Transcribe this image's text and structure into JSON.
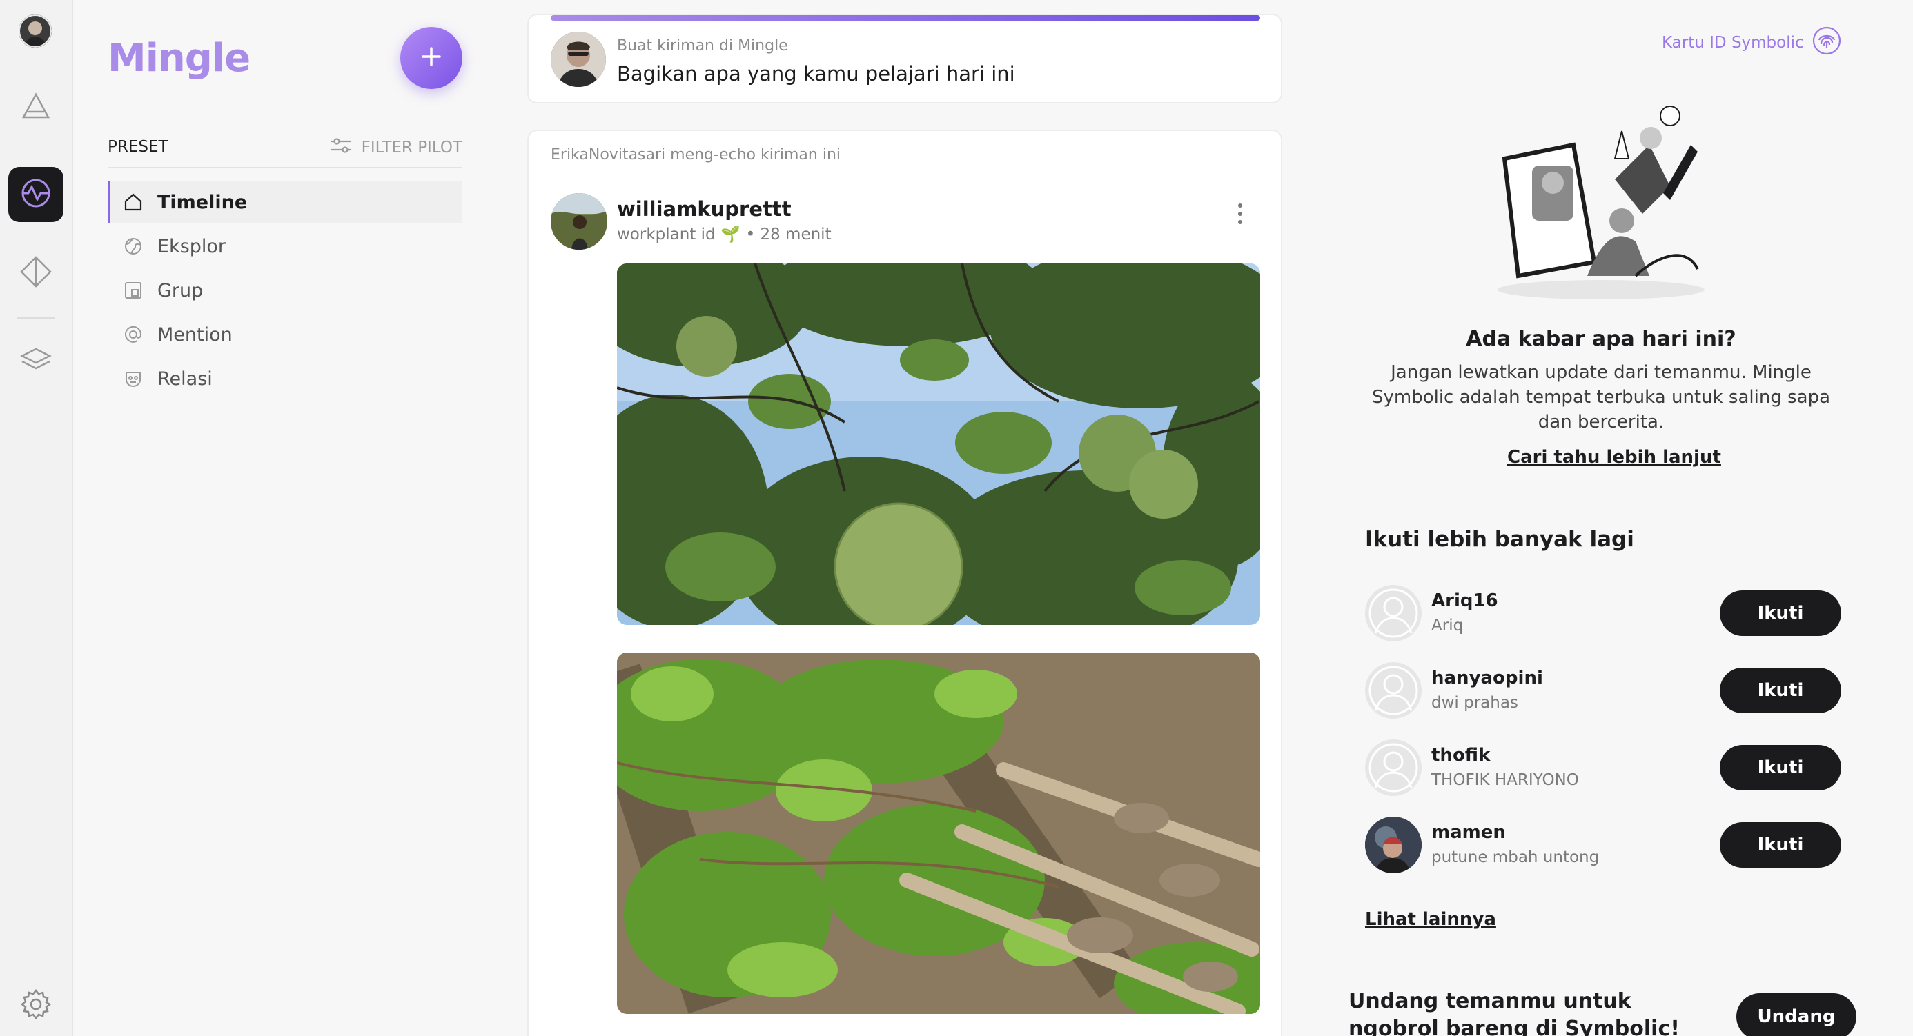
{
  "rail": {
    "items": [
      "profile-avatar",
      "triangle-icon",
      "activity-icon",
      "diamond-icon",
      "layers-icon",
      "gear-icon"
    ]
  },
  "nav": {
    "brand": "Mingle",
    "preset_label": "PRESET",
    "filter_label": "FILTER PILOT",
    "items": [
      {
        "label": "Timeline",
        "icon": "home-icon",
        "active": true
      },
      {
        "label": "Eksplor",
        "icon": "globe-icon",
        "active": false
      },
      {
        "label": "Grup",
        "icon": "group-icon",
        "active": false
      },
      {
        "label": "Mention",
        "icon": "at-icon",
        "active": false
      },
      {
        "label": "Relasi",
        "icon": "relations-icon",
        "active": false
      }
    ]
  },
  "composer": {
    "hint": "Buat kiriman di Mingle",
    "prompt": "Bagikan apa yang kamu pelajari hari ini"
  },
  "post": {
    "echo_note": "ErikaNovitasari meng-echo kiriman ini",
    "username": "williamkuprettt",
    "group": "workplant id 🌱",
    "time": "• 28 menit"
  },
  "sidebar": {
    "kartu_label": "Kartu ID Symbolic",
    "promo_title": "Ada kabar apa hari ini?",
    "promo_text": "Jangan lewatkan update dari temanmu. Mingle Symbolic adalah tempat terbuka untuk saling sapa dan bercerita.",
    "promo_link": "Cari tahu lebih lanjut",
    "follow_title": "Ikuti lebih banyak lagi",
    "follow": [
      {
        "name": "Ariq16",
        "sub": "Ariq",
        "button": "Ikuti"
      },
      {
        "name": "hanyaopini",
        "sub": "dwi  prahas",
        "button": "Ikuti"
      },
      {
        "name": "thofik",
        "sub": "THOFIK HARIYONO",
        "button": "Ikuti"
      },
      {
        "name": "mamen",
        "sub": "putune mbah untong",
        "button": "Ikuti"
      }
    ],
    "see_more": "Lihat lainnya",
    "invite_text": "Undang temanmu untuk ngobrol bareng di Symbolic!",
    "invite_button": "Undang"
  },
  "colors": {
    "accent": "#a98be8",
    "accent_dark": "#6d4fe0",
    "button_dark": "#1b1b1d"
  }
}
